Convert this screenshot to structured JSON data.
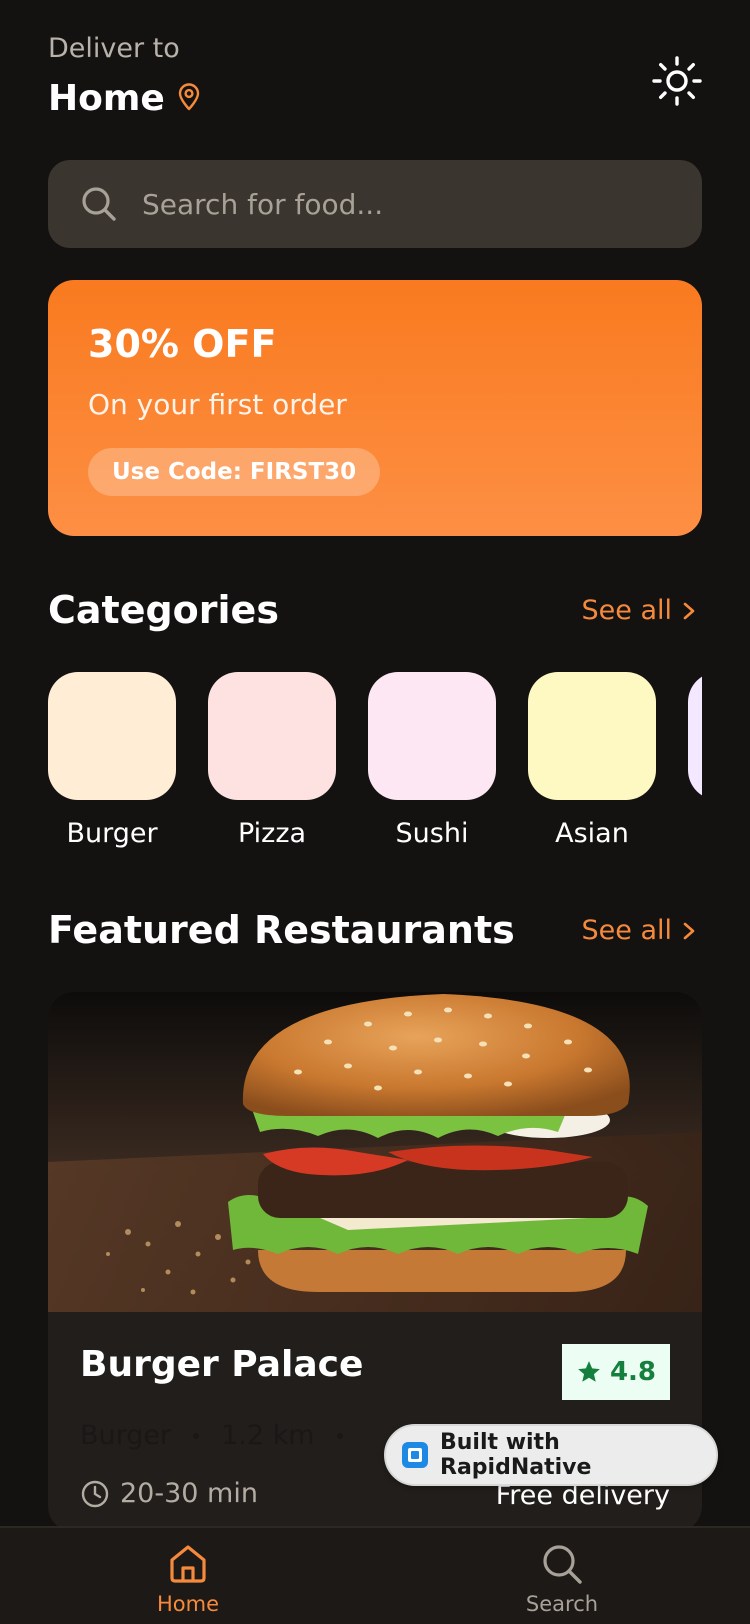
{
  "header": {
    "deliver_label": "Deliver to",
    "location": "Home",
    "location_icon": "map-pin-icon",
    "theme_icon": "sun-icon"
  },
  "search": {
    "placeholder": "Search for food...",
    "value": ""
  },
  "promo": {
    "title": "30% OFF",
    "subtitle": "On your first order",
    "code_label": "Use Code: FIRST30"
  },
  "categories_section": {
    "title": "Categories",
    "see_all": "See all",
    "items": [
      {
        "label": "Burger",
        "color": "#ffedd5"
      },
      {
        "label": "Pizza",
        "color": "#fee2e2"
      },
      {
        "label": "Sushi",
        "color": "#fce7f3"
      },
      {
        "label": "Asian",
        "color": "#fef9c3"
      },
      {
        "label": "",
        "color": "#f3e8ff"
      }
    ]
  },
  "featured_section": {
    "title": "Featured Restaurants",
    "see_all": "See all",
    "restaurants": [
      {
        "name": "Burger Palace",
        "rating": "4.8",
        "cuisine": "Burger",
        "distance": "1.2 km",
        "delivery_time": "20-30 min",
        "delivery_fee": "Free delivery"
      }
    ]
  },
  "badge": {
    "text": "Built with RapidNative"
  },
  "tabs": [
    {
      "label": "Home",
      "icon": "home-icon",
      "active": true
    },
    {
      "label": "Search",
      "icon": "search-icon",
      "active": false
    }
  ],
  "colors": {
    "background": "#141210",
    "accent": "#f68a3c",
    "promo_start": "#f97a1f",
    "promo_end": "#fd8f44",
    "rating_text": "#15803d",
    "inactive_tab": "#a8a198"
  }
}
